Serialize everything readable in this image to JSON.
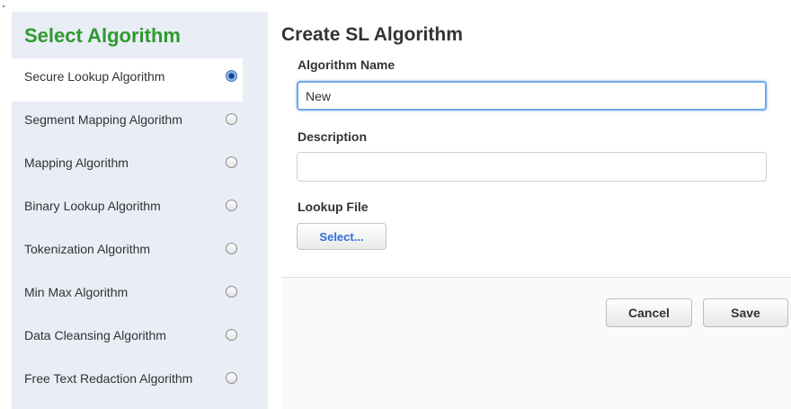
{
  "sidebar": {
    "title": "Select Algorithm",
    "items": [
      {
        "label": "Secure Lookup Algorithm",
        "selected": true
      },
      {
        "label": "Segment Mapping Algorithm",
        "selected": false
      },
      {
        "label": "Mapping Algorithm",
        "selected": false
      },
      {
        "label": "Binary Lookup Algorithm",
        "selected": false
      },
      {
        "label": "Tokenization Algorithm",
        "selected": false
      },
      {
        "label": "Min Max Algorithm",
        "selected": false
      },
      {
        "label": "Data Cleansing Algorithm",
        "selected": false
      },
      {
        "label": "Free Text Redaction Algorithm",
        "selected": false
      }
    ]
  },
  "form": {
    "title": "Create SL Algorithm",
    "name_label": "Algorithm Name",
    "name_value": "New",
    "description_label": "Description",
    "description_value": "",
    "lookup_label": "Lookup File",
    "select_button": "Select..."
  },
  "footer": {
    "cancel_label": "Cancel",
    "save_label": "Save"
  },
  "colors": {
    "sidebar_bg": "#e9edf5",
    "title_green": "#2e9a2e",
    "link_blue": "#2f6fd6",
    "focus_blue": "#6fa7e8"
  }
}
